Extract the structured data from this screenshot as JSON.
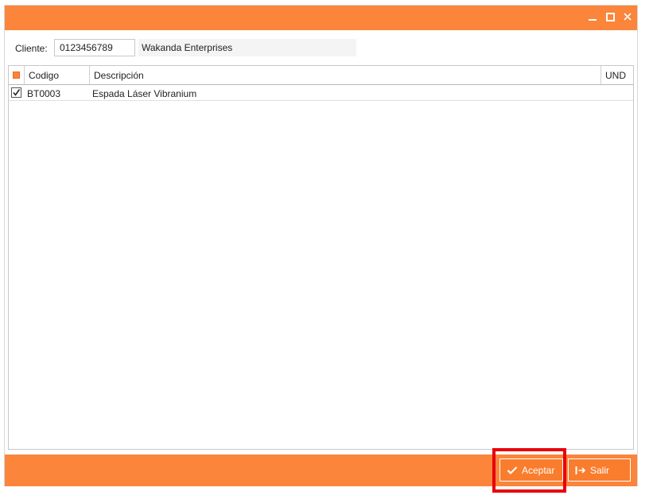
{
  "window_controls": {
    "minimize_icon": "minimize-icon",
    "maximize_icon": "maximize-icon",
    "close_icon": "close-icon"
  },
  "client": {
    "label": "Cliente:",
    "code_value": "0123456789",
    "name": "Wakanda Enterprises"
  },
  "grid": {
    "columns": {
      "code": "Codigo",
      "description": "Descripción",
      "unit": "UND"
    },
    "rows": [
      {
        "checked": true,
        "code": "BT0003",
        "description": "Espada Láser Vibranium",
        "unit": ""
      }
    ]
  },
  "footer": {
    "accept_label": "Aceptar",
    "accept_icon": "checkmark-icon",
    "exit_label": "Salir",
    "exit_icon": "exit-icon"
  },
  "colors": {
    "accent": "#fb853b",
    "highlight": "#e8000b"
  }
}
